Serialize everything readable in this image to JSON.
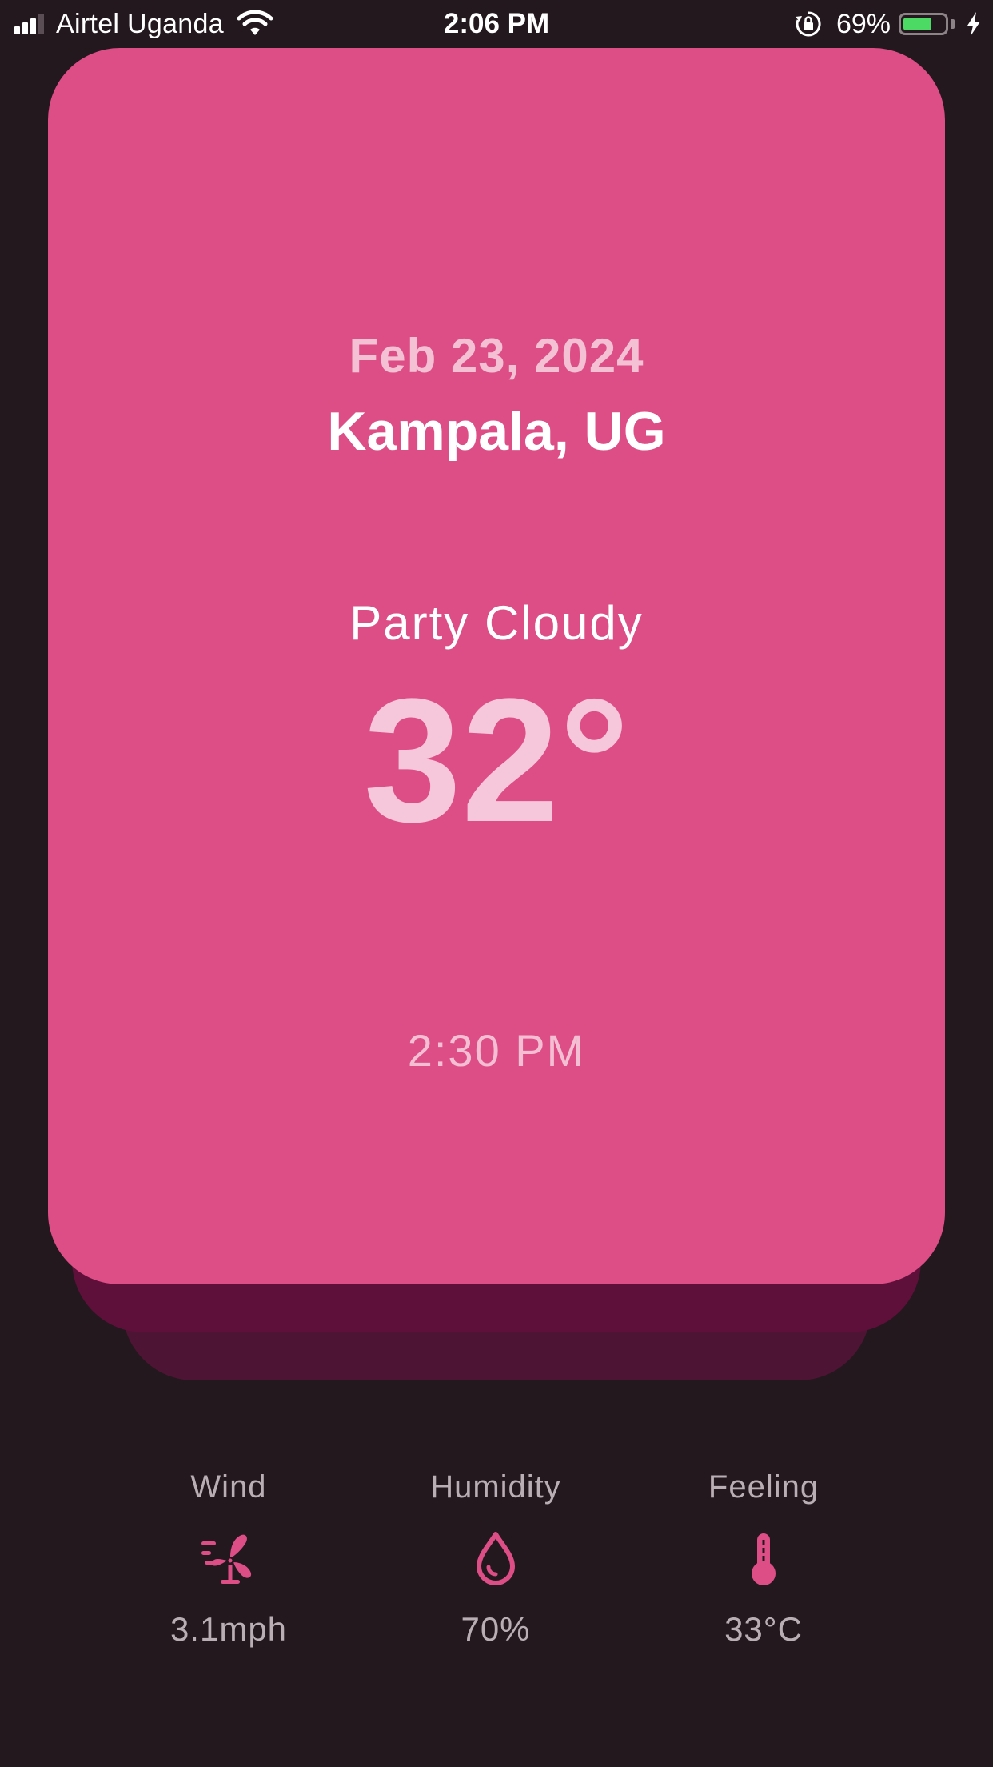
{
  "status_bar": {
    "carrier": "Airtel Uganda",
    "time": "2:06 PM",
    "battery_percent": "69%",
    "battery_level": 0.69,
    "battery_color": "#4CD964"
  },
  "card": {
    "date": "Feb 23, 2024",
    "location": "Kampala, UG",
    "condition": "Party Cloudy",
    "temperature": "32°",
    "time": "2:30 PM",
    "accent_color": "#DD4E87"
  },
  "stats": {
    "wind": {
      "label": "Wind",
      "value": "3.1mph",
      "icon": "fan-wind-icon"
    },
    "humidity": {
      "label": "Humidity",
      "value": "70%",
      "icon": "water-drop-icon"
    },
    "feeling": {
      "label": "Feeling",
      "value": "33°C",
      "icon": "thermometer-icon"
    }
  },
  "colors": {
    "background": "#24181F",
    "card": "#DD4E87",
    "card_shadow_1": "#5E103A",
    "card_shadow_2": "#4E1433",
    "icon": "#DD4E87",
    "stat_text": "#B9AEB4"
  }
}
